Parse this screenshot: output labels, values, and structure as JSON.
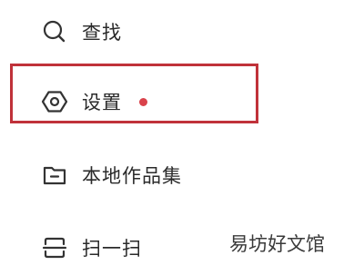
{
  "menu": {
    "items": [
      {
        "label": "查找",
        "icon": "search-icon"
      },
      {
        "label": "设置",
        "icon": "gear-icon",
        "has_notification_dot": true
      },
      {
        "label": "本地作品集",
        "icon": "folder-icon"
      },
      {
        "label": "扫一扫",
        "icon": "scan-icon"
      }
    ]
  },
  "highlight": {
    "color": "#c0323a",
    "target": "设置"
  },
  "notification_dot_color": "#d9424b",
  "watermark": {
    "text": "易坊好文馆"
  }
}
